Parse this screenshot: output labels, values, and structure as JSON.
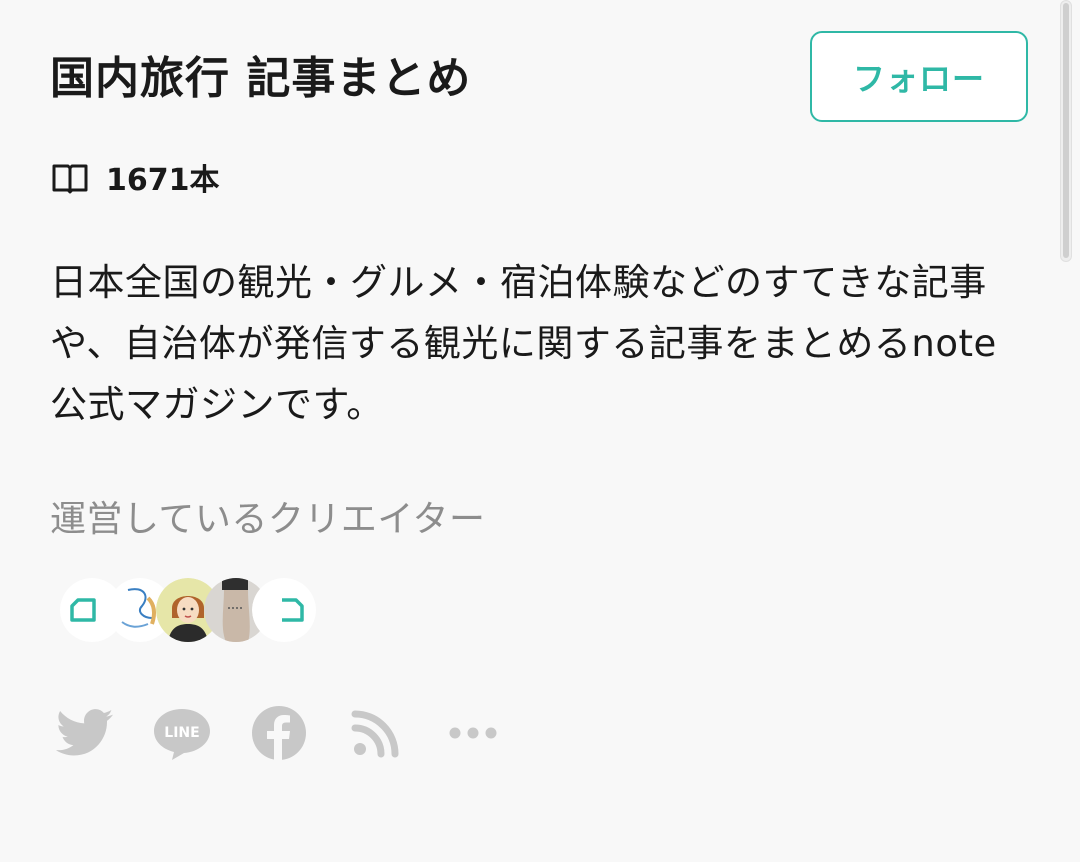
{
  "magazine": {
    "title": "国内旅行 記事まとめ",
    "follow_label": "フォロー",
    "article_count": "1671本",
    "description": "日本全国の観光・グルメ・宿泊体験などのすてきな記事や、自治体が発信する観光に関する記事をまとめるnote公式マガジンです。"
  },
  "creators": {
    "label": "運営しているクリエイター",
    "avatars": [
      {
        "icon": "note-logo-icon"
      },
      {
        "icon": "blue-sketch-avatar"
      },
      {
        "icon": "woman-illustration-avatar"
      },
      {
        "icon": "photo-avatar"
      },
      {
        "icon": "note-logo-icon"
      }
    ]
  },
  "share": {
    "items": [
      {
        "icon": "twitter-icon"
      },
      {
        "icon": "line-icon",
        "text": "LINE"
      },
      {
        "icon": "facebook-icon"
      },
      {
        "icon": "rss-icon"
      },
      {
        "icon": "more-icon"
      }
    ]
  },
  "colors": {
    "accent": "#2fb8a6",
    "text": "#1a1a1a",
    "muted": "#8d8d8d",
    "share_icons": "#c8c8c8",
    "background": "#f8f8f8"
  }
}
